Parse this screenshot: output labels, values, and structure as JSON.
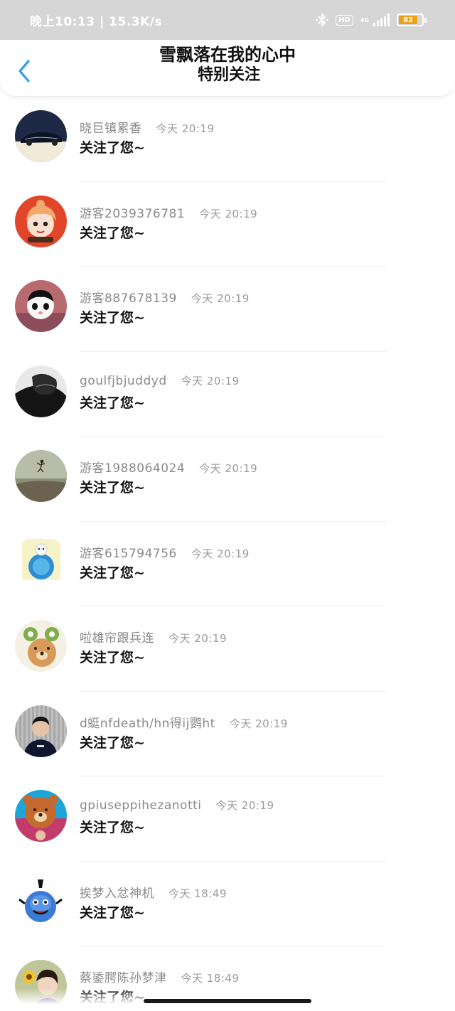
{
  "status_bar": {
    "time_speed": "晚上10:13 | 15.3K/s",
    "hd": "HD",
    "network": "4G",
    "battery": "82",
    "battery_level": 0.82,
    "battery_color": "#f0a11a"
  },
  "header": {
    "back_icon": "chevron-left-icon",
    "title": "雪飘落在我的心中",
    "subtitle": "特别关注",
    "accent": "#2a9df4"
  },
  "items": [
    {
      "username": "晓巨镇累香",
      "time": "今天 20:19",
      "action": "关注了您~",
      "avatar": "car"
    },
    {
      "username": "游客2039376781",
      "time": "今天 20:19",
      "action": "关注了您~",
      "avatar": "cartoon-girl"
    },
    {
      "username": "游客887678139",
      "time": "今天 20:19",
      "action": "关注了您~",
      "avatar": "panda"
    },
    {
      "username": "goulfjbjuddyd",
      "time": "今天 20:19",
      "action": "关注了您~",
      "avatar": "bw-person"
    },
    {
      "username": "游客1988064024",
      "time": "今天 20:19",
      "action": "关注了您~",
      "avatar": "jumping-person"
    },
    {
      "username": "游客615794756",
      "time": "今天 20:19",
      "action": "关注了您~",
      "avatar": "cute-blue"
    },
    {
      "username": "啦雄帘跟兵连",
      "time": "今天 20:19",
      "action": "关注了您~",
      "avatar": "bear-frog"
    },
    {
      "username": "d蜓nfdeath/hn得ij鹦ht",
      "time": "今天 20:19",
      "action": "关注了您~",
      "avatar": "young-man"
    },
    {
      "username": "gpiuseppihezanotti",
      "time": "今天 20:19",
      "action": "关注了您~",
      "avatar": "bear-head"
    },
    {
      "username": "挨梦入忿神机",
      "time": "今天 18:49",
      "action": "关注了您~",
      "avatar": "blue-genie"
    },
    {
      "username": "蔡鋈腭陈孙梦津",
      "time": "今天 18:49",
      "action": "关注了您~",
      "avatar": "girl-flower"
    }
  ]
}
